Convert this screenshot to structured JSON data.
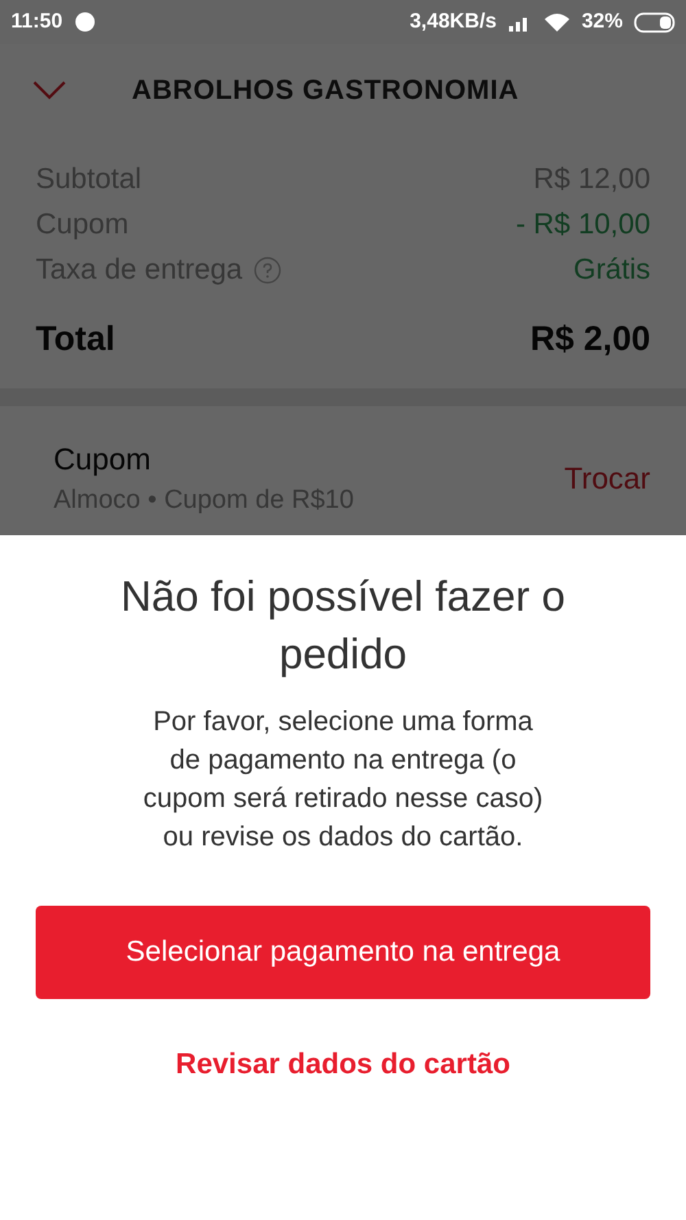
{
  "status_bar": {
    "time": "11:50",
    "speed": "3,48KB/s",
    "battery": "32%"
  },
  "header": {
    "title": "ABROLHOS GASTRONOMIA"
  },
  "summary": [
    {
      "label": "Subtotal",
      "value": "R$ 12,00",
      "kind": "plain"
    },
    {
      "label": "Cupom",
      "value": "- R$ 10,00",
      "kind": "discount"
    },
    {
      "label": "Taxa de entrega",
      "value": "Grátis",
      "kind": "fee"
    }
  ],
  "total": {
    "label": "Total",
    "value": "R$ 2,00"
  },
  "coupon": {
    "title": "Cupom",
    "subtitle": "Almoco • Cupom de R$10",
    "action": "Trocar"
  },
  "dialog": {
    "title": "Não foi possível fazer o pedido",
    "message": "Por favor, selecione uma forma de pagamento na entrega (o cupom será retirado nesse caso) ou revise os dados do cartão.",
    "primary": "Selecionar pagamento na entrega",
    "secondary": "Revisar dados do cartão"
  }
}
